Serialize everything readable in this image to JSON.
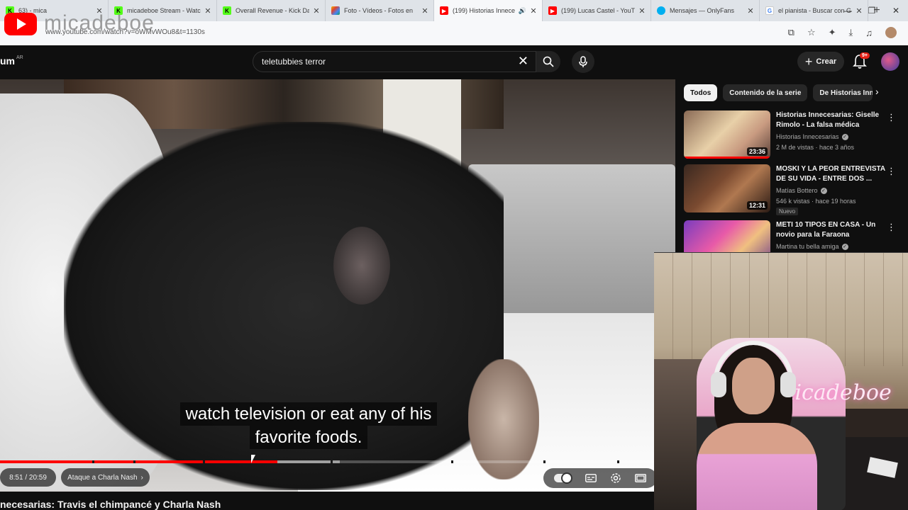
{
  "browser": {
    "tabs": [
      {
        "title": "63) - mica",
        "favicon": "k-green",
        "active": false
      },
      {
        "title": "micadeboe Stream - Watc",
        "favicon": "kick",
        "active": false
      },
      {
        "title": "Overall Revenue - Kick Da",
        "favicon": "kick",
        "active": false
      },
      {
        "title": "Foto - Vídeos - Fotos en",
        "favicon": "photos",
        "active": false
      },
      {
        "title": "(199) Historias Innece",
        "favicon": "youtube",
        "active": true,
        "audio": true
      },
      {
        "title": "(199) Lucas Castel - YouTu",
        "favicon": "youtube",
        "active": false
      },
      {
        "title": "Mensajes — OnlyFans",
        "favicon": "onlyfans",
        "active": false
      },
      {
        "title": "el pianista - Buscar con G",
        "favicon": "google",
        "active": false
      }
    ],
    "url": "www.youtube.com/watch?v=oWMvWOu8&t=1130s",
    "watermark": "micadeboe"
  },
  "header": {
    "brand_fragment": "um",
    "brand_region": "AR",
    "search_value": "teletubbies terror",
    "create_label": "Crear",
    "notif_badge": "9+"
  },
  "player": {
    "subtitle_line1": "watch television or eat any of his",
    "subtitle_line2": "favorite foods.",
    "time": "8:51 / 20:59",
    "chapter": "Ataque a Charla Nash",
    "progress_played_fraction": 0.424,
    "progress_buffered_fraction": 0.52
  },
  "video_title": "necesarias: Travis el chimpancé y Charla Nash",
  "sidebar": {
    "chips": [
      "Todos",
      "Contenido de la serie",
      "De Historias Inn"
    ],
    "recommendations": [
      {
        "title": "Historias Innecesarias: Giselle Rimolo - La falsa médica",
        "channel": "Historias Innecesarias",
        "verified": true,
        "meta": "2 M de vistas · hace 3 años",
        "duration": "23:36",
        "watched_fraction": 1.0,
        "badge": ""
      },
      {
        "title": "MOSKI Y LA PEOR ENTREVISTA DE SU VIDA - ENTRE DOS ...",
        "channel": "Matías Bottero",
        "verified": true,
        "meta": "546 k vistas · hace 19 horas",
        "duration": "12:31",
        "watched_fraction": 0,
        "badge": "Nuevo"
      },
      {
        "title": "METI 10 TIPOS EN CASA - Un novio para la Faraona",
        "channel": "Martina tu bella amiga",
        "verified": true,
        "meta": "",
        "duration": "",
        "watched_fraction": 0,
        "badge": ""
      }
    ]
  },
  "webcam": {
    "neon_sign": "micadeboe"
  }
}
